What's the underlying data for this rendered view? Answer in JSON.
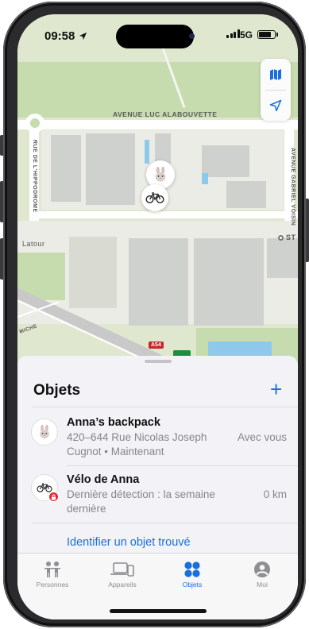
{
  "status_bar": {
    "time": "09:58",
    "network": "5G"
  },
  "map": {
    "street_labels": {
      "avenue_top": "AVENUE LUC ALABOUVETTE",
      "rue_left": "RUE DE L'HIPPODROME",
      "avenue_right": "AVENUE GABRIEL VOISIN",
      "latour": "Latour",
      "st": "ST",
      "miche": "MICHE",
      "highway": "A54"
    },
    "controls": {
      "map_mode_icon": "map-icon",
      "location_icon": "location-arrow-icon"
    },
    "pins": [
      "rabbit-icon",
      "bicycle-icon"
    ]
  },
  "sheet": {
    "title": "Objets",
    "add_icon": "+",
    "items": [
      {
        "name": "Anna’s backpack",
        "subtitle": "420–644 Rue Nicolas Joseph Cugnot • Maintenant",
        "status": "Avec vous",
        "icon": "rabbit-icon"
      },
      {
        "name": "Vélo de Anna",
        "subtitle": "Dernière détection : la semaine dernière",
        "status": "0 km",
        "icon": "bicycle-icon",
        "badge": "lock-icon"
      }
    ],
    "identify_link": "Identifier un objet trouvé"
  },
  "tabbar": {
    "tabs": [
      {
        "label": "Personnes",
        "icon": "people-icon",
        "active": false
      },
      {
        "label": "Appareils",
        "icon": "devices-icon",
        "active": false
      },
      {
        "label": "Objets",
        "icon": "items-icon",
        "active": true
      },
      {
        "label": "Moi",
        "icon": "me-icon",
        "active": false
      }
    ]
  },
  "colors": {
    "accent": "#1a6fe0",
    "map_green": "#dfe7cf",
    "badge_red": "#e0282e"
  }
}
